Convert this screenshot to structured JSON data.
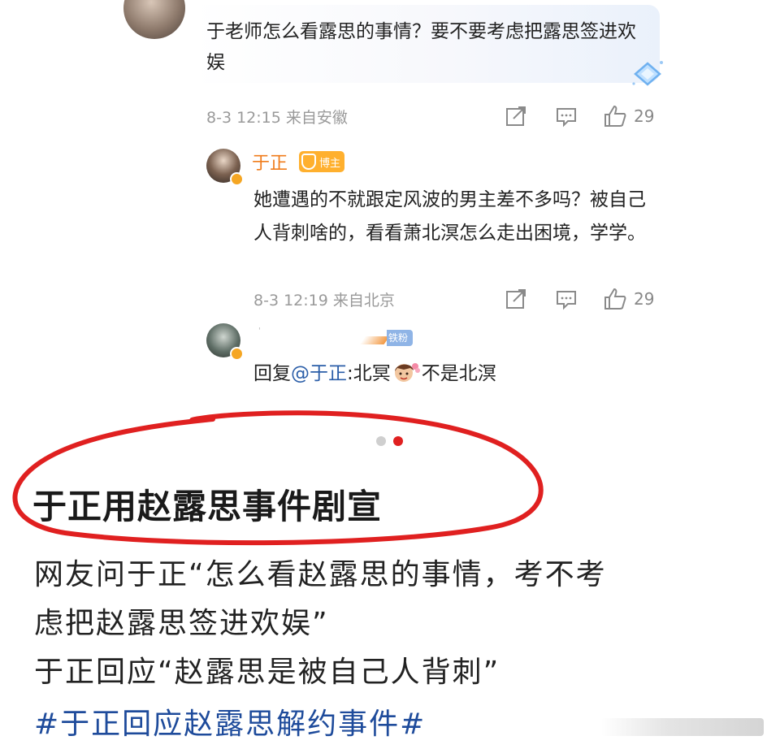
{
  "question": {
    "text": "于老师怎么看露思的事情？要不要考虑把露思签进欢娱",
    "time": "8-3 12:15 来自安徽",
    "likes": "29"
  },
  "reply": {
    "author": "于正",
    "badge": "博主",
    "text": "她遭遇的不就跟定风波的男主差不多吗？被自己人背刺啥的，看看萧北溟怎么走出困境，学学。",
    "time": "8-3 12:19 来自北京",
    "likes": "29"
  },
  "fan_reply": {
    "badge": "铁粉1",
    "prefix": "回复",
    "mention": "@于正",
    "text_before": ":北冥",
    "text_after": "不是北溟"
  },
  "carousel": {
    "active_index": 1,
    "total": 2
  },
  "article": {
    "headline": "于正用赵露思事件剧宣",
    "line1": "网友问于正“怎么看赵露思的事情，考不考",
    "line2": "虑把赵露思签进欢娱”",
    "line3": "于正回应“赵露思是被自己人背刺”",
    "hashtag": "#于正回应赵露思解约事件#"
  },
  "colors": {
    "link": "#2b5ea8",
    "author": "#f07c1b",
    "hashtag": "#1e4b9b",
    "circle": "#e02020"
  }
}
